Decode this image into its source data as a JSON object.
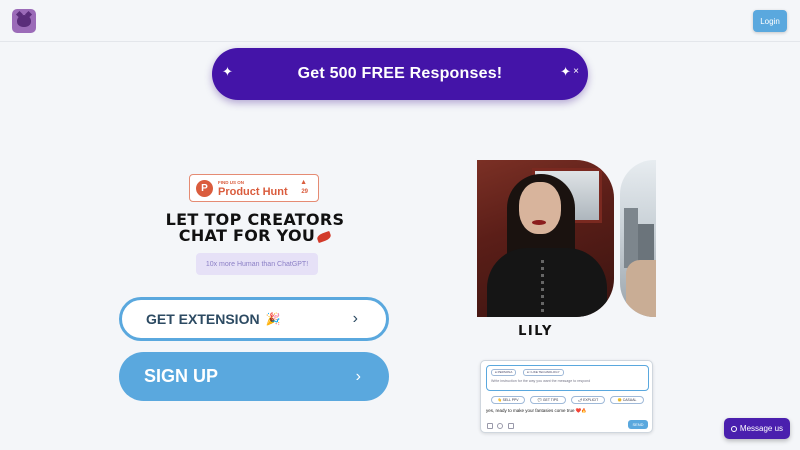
{
  "header": {
    "logo_icon": "devil-cat-logo-icon",
    "login_label": "Login"
  },
  "promo": {
    "text": "Get 500 FREE Responses!",
    "sparkle_icon": "sparkle-icon",
    "close_label": "×"
  },
  "product_hunt": {
    "small_label": "FIND US ON",
    "name": "Product Hunt",
    "letter": "P",
    "arrow": "▲",
    "count": "29"
  },
  "hero": {
    "headline_line1": "LET TOP CREATORS",
    "headline_line2": "CHAT FOR YOU",
    "tagline": "10x more Human than ChatGPT!",
    "extension_label": "GET EXTENSION",
    "extension_emoji": "🎉",
    "signup_label": "SIGN UP",
    "chevron": "›"
  },
  "creator": {
    "name": "LILY"
  },
  "chat_demo": {
    "tags": [
      "● PERSONA",
      "● I LIKE TECHNOLOGY"
    ],
    "instruction": "Write instruction for the way you want the message to respond",
    "chips": [
      "👋 SELL PPV",
      "💬 GET TIPS",
      "🌶 EXPLICIT",
      "😊 CASUAL"
    ],
    "reply": "yes, ready to make your fantasies come true ❤️🔥",
    "send_label": "SEND"
  },
  "support": {
    "label": "Message us"
  },
  "colors": {
    "brand_purple": "#4414a8",
    "accent_blue": "#5aa8de",
    "product_hunt_orange": "#da5c3d"
  }
}
